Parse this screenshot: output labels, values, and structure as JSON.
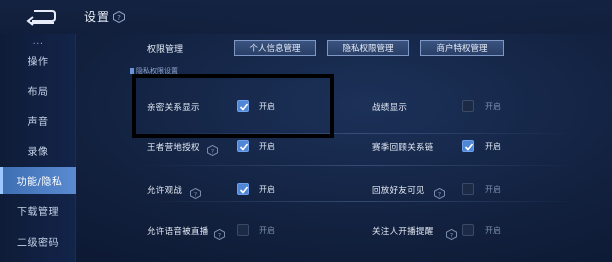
{
  "header": {
    "title": "设置"
  },
  "sidebar": {
    "items": [
      {
        "label": "..."
      },
      {
        "label": "操作"
      },
      {
        "label": "布局"
      },
      {
        "label": "声音"
      },
      {
        "label": "录像"
      },
      {
        "label": "功能/隐私"
      },
      {
        "label": "下载管理"
      },
      {
        "label": "二级密码"
      }
    ],
    "active_index": 5
  },
  "permissions": {
    "label": "权限管理",
    "buttons": [
      "个人信息管理",
      "隐私权限管理",
      "商户特权管理"
    ]
  },
  "section_tag": "隐私权限设置",
  "settings": {
    "left": [
      {
        "label": "亲密关系显示",
        "checked": true,
        "state": "开启",
        "has_help": false
      },
      {
        "label": "王者营地授权",
        "checked": true,
        "state": "开启",
        "has_help": true
      },
      {
        "label": "允许观战",
        "checked": true,
        "state": "开启",
        "has_help": true
      },
      {
        "label": "允许语音被直播",
        "checked": false,
        "state": "开启",
        "has_help": true
      }
    ],
    "right": [
      {
        "label": "战绩显示",
        "checked": false,
        "state": "开启",
        "has_help": false
      },
      {
        "label": "赛季回顾关系链",
        "checked": true,
        "state": "开启",
        "has_help": false
      },
      {
        "label": "回放好友可见",
        "checked": false,
        "state": "开启",
        "has_help": true
      },
      {
        "label": "关注人开播提醒",
        "checked": false,
        "state": "开启",
        "has_help": true
      }
    ]
  },
  "colors": {
    "accent": "#4f86d6",
    "active_tab": "#5a8ad0",
    "background": "#12213f"
  }
}
